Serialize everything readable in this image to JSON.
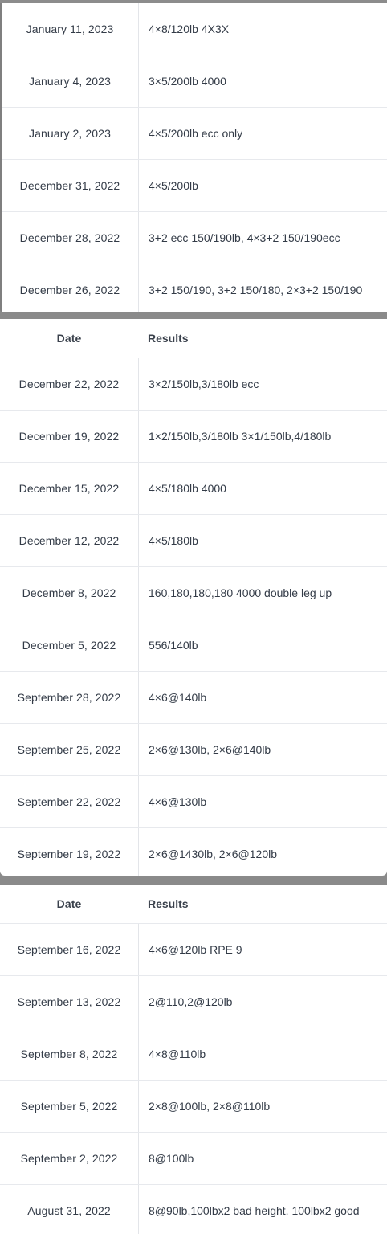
{
  "table1": {
    "rows": [
      {
        "date": "January 11, 2023",
        "result": "4×8/120lb 4X3X"
      },
      {
        "date": "January 4, 2023",
        "result": "3×5/200lb 4000"
      },
      {
        "date": "January 2, 2023",
        "result": "4×5/200lb ecc only"
      },
      {
        "date": "December 31, 2022",
        "result": "4×5/200lb"
      },
      {
        "date": "December 28, 2022",
        "result": "3+2 ecc 150/190lb, 4×3+2 150/190ecc"
      },
      {
        "date": "December 26, 2022",
        "result": "3+2 150/190, 3+2 150/180, 2×3+2 150/190"
      }
    ]
  },
  "table2": {
    "header": {
      "date": "Date",
      "result": "Results"
    },
    "rows": [
      {
        "date": "December 22, 2022",
        "result": "3×2/150lb,3/180lb ecc"
      },
      {
        "date": "December 19, 2022",
        "result": "1×2/150lb,3/180lb 3×1/150lb,4/180lb"
      },
      {
        "date": "December 15, 2022",
        "result": "4×5/180lb 4000"
      },
      {
        "date": "December 12, 2022",
        "result": "4×5/180lb"
      },
      {
        "date": "December 8, 2022",
        "result": "160,180,180,180 4000 double leg up"
      },
      {
        "date": "December 5, 2022",
        "result": "556/140lb"
      },
      {
        "date": "September 28, 2022",
        "result": "4×6@140lb"
      },
      {
        "date": "September 25, 2022",
        "result": "2×6@130lb, 2×6@140lb"
      },
      {
        "date": "September 22, 2022",
        "result": "4×6@130lb"
      },
      {
        "date": "September 19, 2022",
        "result": "2×6@1430lb, 2×6@120lb"
      }
    ]
  },
  "table3": {
    "header": {
      "date": "Date",
      "result": "Results"
    },
    "rows": [
      {
        "date": "September 16, 2022",
        "result": "4×6@120lb RPE 9"
      },
      {
        "date": "September 13, 2022",
        "result": "2@110,2@120lb"
      },
      {
        "date": "September 8, 2022",
        "result": "4×8@110lb"
      },
      {
        "date": "September 5, 2022",
        "result": "2×8@100lb, 2×8@110lb"
      },
      {
        "date": "September 2, 2022",
        "result": "8@100lb"
      },
      {
        "date": "August 31, 2022",
        "result": "8@90lb,100lbx2 bad height. 100lbx2 good"
      }
    ]
  }
}
